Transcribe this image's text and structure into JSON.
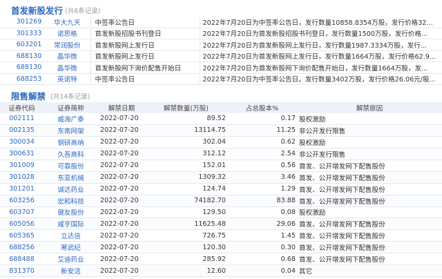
{
  "ipo": {
    "title": "首发新股发行",
    "count": "(共6条记录)",
    "rows": [
      {
        "code": "301269",
        "name": "华大九天",
        "event": "中签率公告日",
        "desc": "2022年7月20日为中签率公告日，发行数量10858.8354万股，发行价格32..."
      },
      {
        "code": "301333",
        "name": "诺思格",
        "event": "首发新股招股书刊登日",
        "desc": "2022年7月20日为首发新股招股书刊登日，发行数量1500万股，发行价格..."
      },
      {
        "code": "603201",
        "name": "常润股份",
        "event": "首发新股网上发行日",
        "desc": "2022年7月20日为首发新股网上发行日，发行数量1987.3334万股，发行..."
      },
      {
        "code": "688130",
        "name": "晶华微",
        "event": "首发新股网上发行日",
        "desc": "2022年7月20日为首发新股网上发行日，发行数量1664万股，发行价格62.9..."
      },
      {
        "code": "688130",
        "name": "晶华微",
        "event": "首发新股网下询价配售开始日",
        "desc": "2022年7月20日为首发新股网下询价配售开始日，发行数量1664万股，发..."
      },
      {
        "code": "688253",
        "name": "英诺特",
        "event": "中签率公告日",
        "desc": "2022年7月20日为中签率公告日，发行数量3402万股，发行价格26.06元/股..."
      }
    ]
  },
  "unlock": {
    "title": "限售解禁",
    "count": "(共14条记录)",
    "headers": {
      "code": "证券代码",
      "name": "证券简称",
      "date": "解禁日期",
      "shares": "解禁数量(万股)",
      "pct": "占总股本%",
      "reason": "解禁原因"
    },
    "rows": [
      {
        "code": "002111",
        "name": "威海广泰",
        "date": "2022-07-20",
        "shares": "89.52",
        "pct": "0.17",
        "reason": "股权激励"
      },
      {
        "code": "002135",
        "name": "东南网架",
        "date": "2022-07-20",
        "shares": "13114.75",
        "pct": "11.25",
        "reason": "非公开发行限售"
      },
      {
        "code": "300034",
        "name": "钢研高纳",
        "date": "2022-07-20",
        "shares": "302.04",
        "pct": "0.62",
        "reason": "股权激励"
      },
      {
        "code": "300631",
        "name": "久吾高科",
        "date": "2022-07-20",
        "shares": "312.12",
        "pct": "2.54",
        "reason": "非公开发行限售"
      },
      {
        "code": "301009",
        "name": "可靠股份",
        "date": "2022-07-20",
        "shares": "152.01",
        "pct": "0.56",
        "reason": "首发、公开增发网下配售股份"
      },
      {
        "code": "301028",
        "name": "东亚机械",
        "date": "2022-07-20",
        "shares": "1309.32",
        "pct": "3.46",
        "reason": "首发、公开增发网下配售股份"
      },
      {
        "code": "301201",
        "name": "诚达药业",
        "date": "2022-07-20",
        "shares": "124.74",
        "pct": "1.29",
        "reason": "首发、公开增发网下配售股份"
      },
      {
        "code": "603256",
        "name": "宏和科技",
        "date": "2022-07-20",
        "shares": "74182.70",
        "pct": "83.88",
        "reason": "首发、公开增发网下配售股份"
      },
      {
        "code": "603707",
        "name": "健友股份",
        "date": "2022-07-20",
        "shares": "129.50",
        "pct": "0.08",
        "reason": "股权激励"
      },
      {
        "code": "605056",
        "name": "咸亨国际",
        "date": "2022-07-20",
        "shares": "11625.48",
        "pct": "29.06",
        "reason": "首发、公开增发网下配售股份"
      },
      {
        "code": "605365",
        "name": "立达信",
        "date": "2022-07-20",
        "shares": "726.75",
        "pct": "1.45",
        "reason": "首发、公开增发网下配售股份"
      },
      {
        "code": "688256",
        "name": "寒武纪",
        "date": "2022-07-20",
        "shares": "120.30",
        "pct": "0.30",
        "reason": "首发、公开增发网下配售股份"
      },
      {
        "code": "688488",
        "name": "艾迪药业",
        "date": "2022-07-20",
        "shares": "285.92",
        "pct": "0.68",
        "reason": "首发、公开增发网下配售股份"
      },
      {
        "code": "831370",
        "name": "新安洁",
        "date": "2022-07-20",
        "shares": "12.60",
        "pct": "0.04",
        "reason": "其它"
      }
    ]
  }
}
